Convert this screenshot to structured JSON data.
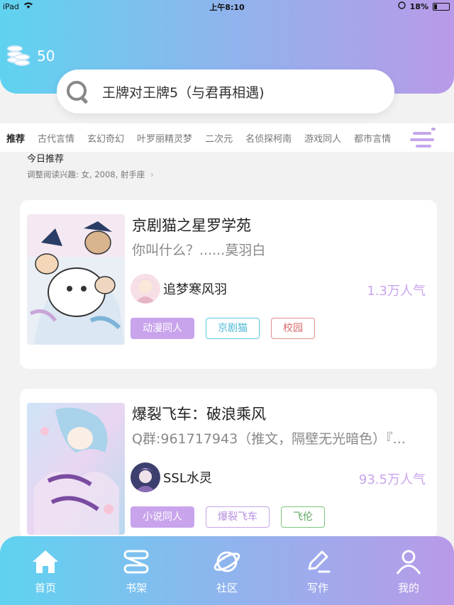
{
  "status": {
    "device": "iPad",
    "time": "上午8:10",
    "battery": "18%"
  },
  "coins": {
    "count": "50"
  },
  "search": {
    "text": "王牌对王牌5（与君再相遇)"
  },
  "tabs": [
    "推荐",
    "古代言情",
    "玄幻奇幻",
    "叶罗丽精灵梦",
    "二次元",
    "名侦探柯南",
    "游戏同人",
    "都市言情"
  ],
  "section": {
    "title": "今日推荐",
    "subtitle": "调整阅读兴趣: 女, 2008, 射手座"
  },
  "books": [
    {
      "title": "京剧猫之星罗学苑",
      "description": "你叫什么？......莫羽白",
      "author": "追梦寒风羽",
      "popularity": "1.3万人气",
      "tags": [
        "动漫同人",
        "京剧猫",
        "校园"
      ]
    },
    {
      "title": "爆裂飞车：破浪乘风",
      "description": "Q群:961717943（推文，隔壁无光暗色）『...",
      "author": "SSL水灵",
      "popularity": "93.5万人气",
      "tags": [
        "小说同人",
        "爆裂飞车",
        "飞伦"
      ]
    }
  ],
  "nav": {
    "home": "首页",
    "shelf": "书架",
    "community": "社区",
    "write": "写作",
    "mine": "我的"
  },
  "colors": {
    "gradient_start": "#5fd3f0",
    "gradient_end": "#b99ae8",
    "accent": "#c9a4ec"
  }
}
